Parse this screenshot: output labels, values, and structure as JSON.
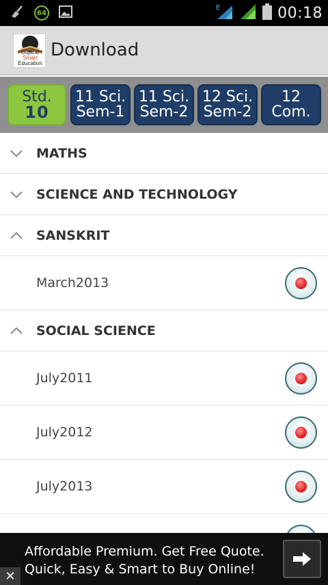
{
  "status_bar": {
    "time": "00:18",
    "battery_badge": "64",
    "network_label": "E",
    "icons": [
      "broom-icon",
      "battery-badge-icon",
      "image-icon",
      "signal-e-icon",
      "signal-icon",
      "battery-icon"
    ]
  },
  "header": {
    "title": "Download",
    "logo_text_line1": "Gujarat",
    "logo_text_line2": "Smart",
    "logo_text_line3": "Education"
  },
  "tabs": [
    {
      "line1": "Std.",
      "line2": "10",
      "active": true
    },
    {
      "line1": "11 Sci.",
      "line2": "Sem-1",
      "active": false
    },
    {
      "line1": "11 Sci.",
      "line2": "Sem-2",
      "active": false
    },
    {
      "line1": "12 Sci.",
      "line2": "Sem-2",
      "active": false
    },
    {
      "line1": "12",
      "line2": "Com.",
      "active": false
    }
  ],
  "list": {
    "groups": [
      {
        "label": "MATHS",
        "expanded": false,
        "items": []
      },
      {
        "label": "SCIENCE AND TECHNOLOGY",
        "expanded": false,
        "items": []
      },
      {
        "label": "SANSKRIT",
        "expanded": true,
        "items": [
          "March2013"
        ]
      },
      {
        "label": "SOCIAL SCIENCE",
        "expanded": true,
        "items": [
          "July2011",
          "July2012",
          "July2013"
        ]
      }
    ]
  },
  "ad": {
    "line1": "Affordable Premium. Get Free Quote.",
    "line2": "Quick, Easy & Smart to Buy Online!",
    "close_label": "✕"
  },
  "colors": {
    "tab_active_bg": "#8dc63f",
    "tab_bg": "#1f3d66",
    "header_bg": "#dcdcdc",
    "download_dot": "#e02424"
  }
}
